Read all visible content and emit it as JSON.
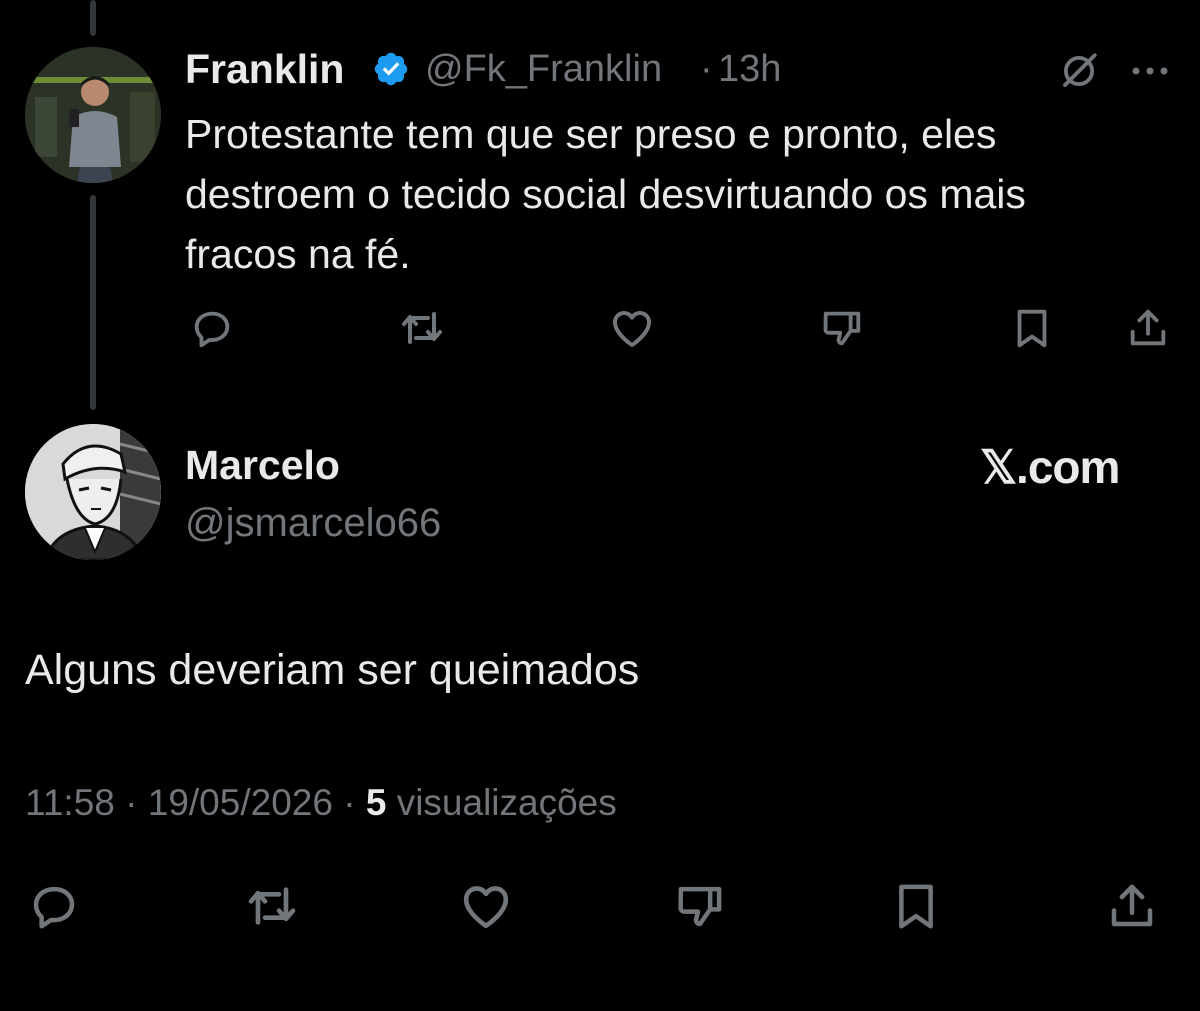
{
  "parent_post": {
    "name": "Franklin",
    "handle": "@Fk_Franklin",
    "separator": "·",
    "time": "13h",
    "text_lines": [
      "Protestante tem que ser preso e pronto, eles",
      "destroem o tecido social desvirtuando os mais",
      "fracos na fé."
    ]
  },
  "reply_post": {
    "name": "Marcelo",
    "handle": "@jsmarcelo66",
    "brand": "𝕏.com",
    "text": "Alguns deveriam ser queimados",
    "meta": {
      "time": "11:58",
      "sep1": "·",
      "date": "19/05/2026",
      "sep2": "·",
      "views_count": "5",
      "views_label": "visualizações"
    }
  },
  "colors": {
    "background": "#000000",
    "text": "#e7e9ea",
    "muted": "#71767b",
    "verified": "#1d9bf0",
    "thread_line": "#333639"
  },
  "icons": [
    "verified-badge-icon",
    "grok-icon",
    "more-icon",
    "reply-icon",
    "repost-icon",
    "like-icon",
    "dislike-icon",
    "bookmark-icon",
    "share-icon"
  ]
}
